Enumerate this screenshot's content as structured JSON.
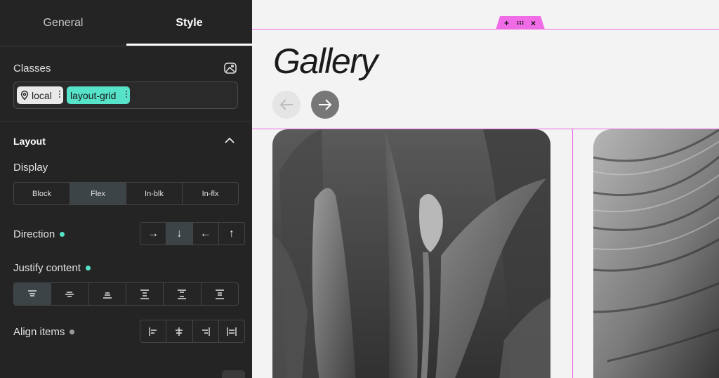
{
  "tabs": {
    "general": "General",
    "style": "Style"
  },
  "classes": {
    "label": "Classes",
    "chips": [
      {
        "label": "local",
        "icon": "map-pin-icon"
      },
      {
        "label": "layout-grid"
      }
    ]
  },
  "layout": {
    "title": "Layout",
    "display_label": "Display",
    "display_options": [
      "Block",
      "Flex",
      "In-blk",
      "In-flx"
    ],
    "display_selected": "Flex",
    "direction_label": "Direction",
    "direction_options": [
      "→",
      "↓",
      "←",
      "↑"
    ],
    "direction_selected": "↓",
    "justify_label": "Justify content",
    "justify_selected_index": 0,
    "align_label": "Align items"
  },
  "colors": {
    "accent": "#57e3c9",
    "selection_outline": "#f06be6",
    "panel_bg": "#242424",
    "inactive_dot": "#9a9a9a"
  },
  "canvas": {
    "title": "Gallery",
    "handle_icons": [
      "plus-icon",
      "drag-grip-icon",
      "close-icon"
    ],
    "handle_glyphs": {
      "add": "+",
      "close": "×"
    }
  }
}
